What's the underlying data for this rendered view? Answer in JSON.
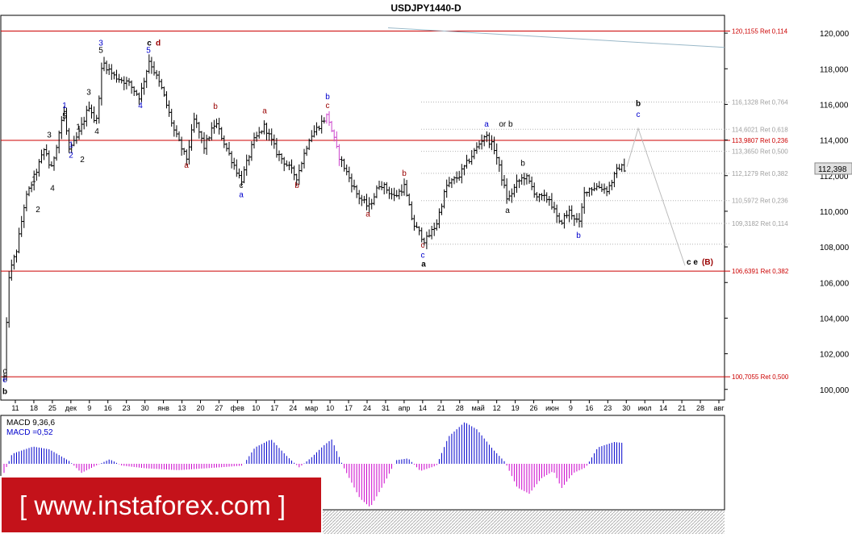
{
  "window": {
    "title": "USDJPY1440-D"
  },
  "colors": {
    "candle": "#000000",
    "resistance": "#cc0000",
    "fibo_dotted": "#b4b4b4",
    "fibo_label": "#a0a0a0",
    "trend": "#9ab8c8",
    "projection": "#bcbcbc",
    "macd_positive": "#0000cc",
    "macd_negative": "#cc00cc",
    "wave_black": "#000000",
    "wave_blue": "#0000cc",
    "wave_red": "#990000",
    "price_box": "#e0e0e0"
  },
  "chart_data": [
    {
      "type": "candlestick",
      "title": "USDJPY1440-D",
      "ylim": [
        99.4,
        121.0
      ],
      "y_ticks": [
        "120,000",
        "118,000",
        "116,000",
        "114,000",
        "112,000",
        "110,000",
        "108,000",
        "106,000",
        "104,000",
        "102,000",
        "100,000"
      ],
      "x_ticks": [
        "11",
        "18",
        "25",
        "дек",
        "9",
        "16",
        "23",
        "30",
        "янв",
        "13",
        "20",
        "27",
        "фев",
        "10",
        "17",
        "24",
        "мар",
        "10",
        "17",
        "24",
        "31",
        "апр",
        "14",
        "21",
        "28",
        "май",
        "12",
        "19",
        "26",
        "июн",
        "9",
        "16",
        "23",
        "30",
        "июл",
        "14",
        "21",
        "28",
        "авг"
      ],
      "current_price": "112,398",
      "resistance_levels": [
        {
          "price": 120.1155,
          "label": "120,1155 Ret 0,114"
        },
        {
          "price": 113.9807,
          "label": "113,9807 Ret 0,236"
        },
        {
          "price": 106.6391,
          "label": "106,6391 Ret 0,382"
        },
        {
          "price": 100.7055,
          "label": "100,7055 Ret 0,500"
        }
      ],
      "fibo_levels": [
        {
          "price": 116.1328,
          "label": "116,1328 Ret 0,764"
        },
        {
          "price": 114.6021,
          "label": "114,6021 Ret 0,618"
        },
        {
          "price": 113.365,
          "label": "113,3650 Ret 0,500"
        },
        {
          "price": 112.1279,
          "label": "112,1279 Ret 0,382"
        },
        {
          "price": 110.5972,
          "label": "110,5972 Ret 0,236"
        },
        {
          "price": 109.3182,
          "label": "109,3182 Ret 0,114"
        },
        {
          "price": 108.15,
          "label": ""
        }
      ],
      "trend_line": [
        {
          "day": 480,
          "price": 120.3
        },
        {
          "day": 897,
          "price": 119.2
        }
      ],
      "projection": [
        {
          "day": 776,
          "price": 112.5
        },
        {
          "day": 790,
          "price": 114.65
        },
        {
          "day": 848,
          "price": 106.95
        }
      ],
      "anchors": [
        {
          "day": 5,
          "price": 100.7
        },
        {
          "day": 9,
          "price": 106.2
        },
        {
          "day": 20,
          "price": 107.9
        },
        {
          "day": 30,
          "price": 110.6
        },
        {
          "day": 42,
          "price": 112.0
        },
        {
          "day": 55,
          "price": 113.6
        },
        {
          "day": 62,
          "price": 112.2
        },
        {
          "day": 78,
          "price": 115.7
        },
        {
          "day": 85,
          "price": 113.3
        },
        {
          "day": 97,
          "price": 114.4
        },
        {
          "day": 110,
          "price": 116.0
        },
        {
          "day": 118,
          "price": 114.8
        },
        {
          "day": 126,
          "price": 118.4
        },
        {
          "day": 140,
          "price": 117.6
        },
        {
          "day": 158,
          "price": 117.2
        },
        {
          "day": 172,
          "price": 116.4
        },
        {
          "day": 184,
          "price": 118.5
        },
        {
          "day": 200,
          "price": 116.8
        },
        {
          "day": 215,
          "price": 114.5
        },
        {
          "day": 230,
          "price": 112.9
        },
        {
          "day": 240,
          "price": 115.2
        },
        {
          "day": 252,
          "price": 113.6
        },
        {
          "day": 266,
          "price": 115.0
        },
        {
          "day": 282,
          "price": 113.3
        },
        {
          "day": 298,
          "price": 111.7
        },
        {
          "day": 313,
          "price": 113.9
        },
        {
          "day": 327,
          "price": 114.8
        },
        {
          "day": 342,
          "price": 113.3
        },
        {
          "day": 367,
          "price": 111.9
        },
        {
          "day": 382,
          "price": 114.1
        },
        {
          "day": 405,
          "price": 115.4
        },
        {
          "day": 418,
          "price": 113.2
        },
        {
          "day": 442,
          "price": 110.9
        },
        {
          "day": 456,
          "price": 110.2
        },
        {
          "day": 470,
          "price": 111.6
        },
        {
          "day": 488,
          "price": 110.8
        },
        {
          "day": 500,
          "price": 111.4
        },
        {
          "day": 511,
          "price": 109.3
        },
        {
          "day": 526,
          "price": 108.3
        },
        {
          "day": 540,
          "price": 109.3
        },
        {
          "day": 552,
          "price": 111.4
        },
        {
          "day": 568,
          "price": 112.0
        },
        {
          "day": 582,
          "price": 113.0
        },
        {
          "day": 600,
          "price": 114.3
        },
        {
          "day": 612,
          "price": 113.5
        },
        {
          "day": 628,
          "price": 110.6
        },
        {
          "day": 640,
          "price": 111.6
        },
        {
          "day": 650,
          "price": 112.0
        },
        {
          "day": 665,
          "price": 110.8
        },
        {
          "day": 680,
          "price": 110.7
        },
        {
          "day": 692,
          "price": 109.3
        },
        {
          "day": 705,
          "price": 110.0
        },
        {
          "day": 717,
          "price": 109.3
        },
        {
          "day": 724,
          "price": 111.2
        },
        {
          "day": 740,
          "price": 111.4
        },
        {
          "day": 752,
          "price": 111.2
        },
        {
          "day": 766,
          "price": 112.5
        },
        {
          "day": 774,
          "price": 112.4
        }
      ],
      "wave_labels": [
        {
          "text": "c",
          "day": 5,
          "price": 100.9,
          "color": "black"
        },
        {
          "text": "e",
          "day": 5,
          "price": 100.4,
          "color": "blue"
        },
        {
          "text": "b",
          "day": 5,
          "price": 99.75,
          "color": "black",
          "bold": true
        },
        {
          "text": "1",
          "day": 41,
          "price": 111.65,
          "color": "black"
        },
        {
          "text": "2",
          "day": 46,
          "price": 109.95,
          "color": "black"
        },
        {
          "text": "3",
          "day": 60,
          "price": 114.15,
          "color": "black"
        },
        {
          "text": "4",
          "day": 64,
          "price": 111.15,
          "color": "black"
        },
        {
          "text": "5",
          "day": 79,
          "price": 115.2,
          "color": "black"
        },
        {
          "text": "1",
          "day": 79,
          "price": 115.8,
          "color": "blue"
        },
        {
          "text": "1",
          "day": 87,
          "price": 113.6,
          "color": "blue"
        },
        {
          "text": "2",
          "day": 87,
          "price": 113.0,
          "color": "blue"
        },
        {
          "text": "1",
          "day": 96,
          "price": 114.6,
          "color": "black"
        },
        {
          "text": "2",
          "day": 101,
          "price": 112.75,
          "color": "black"
        },
        {
          "text": "3",
          "day": 109,
          "price": 116.55,
          "color": "black"
        },
        {
          "text": "4",
          "day": 119,
          "price": 114.35,
          "color": "black"
        },
        {
          "text": "3",
          "day": 124,
          "price": 119.3,
          "color": "blue"
        },
        {
          "text": "5",
          "day": 124,
          "price": 118.9,
          "color": "black"
        },
        {
          "text": "4",
          "day": 173,
          "price": 115.8,
          "color": "blue"
        },
        {
          "text": "c",
          "day": 184,
          "price": 119.3,
          "color": "black",
          "bold": true
        },
        {
          "text": "d",
          "day": 195,
          "price": 119.3,
          "color": "red",
          "bold": true
        },
        {
          "text": "5",
          "day": 183,
          "price": 118.9,
          "color": "blue"
        },
        {
          "text": "a",
          "day": 230,
          "price": 112.45,
          "color": "red"
        },
        {
          "text": "b",
          "day": 266,
          "price": 115.75,
          "color": "red"
        },
        {
          "text": "c",
          "day": 298,
          "price": 111.3,
          "color": "black"
        },
        {
          "text": "a",
          "day": 298,
          "price": 110.8,
          "color": "blue"
        },
        {
          "text": "a",
          "day": 327,
          "price": 115.5,
          "color": "red"
        },
        {
          "text": "b",
          "day": 367,
          "price": 111.3,
          "color": "red"
        },
        {
          "text": "b",
          "day": 405,
          "price": 116.3,
          "color": "blue"
        },
        {
          "text": "c",
          "day": 405,
          "price": 115.8,
          "color": "red"
        },
        {
          "text": "a",
          "day": 455,
          "price": 109.7,
          "color": "red"
        },
        {
          "text": "b",
          "day": 500,
          "price": 112.0,
          "color": "red"
        },
        {
          "text": "c",
          "day": 523,
          "price": 107.95,
          "color": "red"
        },
        {
          "text": "c",
          "day": 523,
          "price": 107.4,
          "color": "blue"
        },
        {
          "text": "a",
          "day": 524,
          "price": 106.9,
          "color": "black",
          "bold": true
        },
        {
          "text": "a",
          "day": 602,
          "price": 114.75,
          "color": "blue"
        },
        {
          "text": "or b",
          "day": 626,
          "price": 114.75,
          "color": "black"
        },
        {
          "text": "b",
          "day": 647,
          "price": 112.55,
          "color": "black"
        },
        {
          "text": "a",
          "day": 628,
          "price": 109.9,
          "color": "black"
        },
        {
          "text": "b",
          "day": 716,
          "price": 108.5,
          "color": "blue"
        },
        {
          "text": "b",
          "day": 790,
          "price": 115.9,
          "color": "black",
          "bold": true
        },
        {
          "text": "c",
          "day": 790,
          "price": 115.3,
          "color": "blue"
        },
        {
          "text": "c e",
          "day": 857,
          "price": 107.0,
          "color": "black",
          "bold": true
        },
        {
          "text": "(B)",
          "day": 876,
          "price": 107.0,
          "color": "red",
          "bold": true
        }
      ]
    },
    {
      "type": "bar",
      "title": "MACD 9,36,6",
      "subtitle": "MACD =0,52",
      "ylim": [
        -2.6,
        2.6
      ],
      "anchors": [
        {
          "day": 4,
          "value": -0.5
        },
        {
          "day": 14,
          "value": 0.55
        },
        {
          "day": 40,
          "value": 0.95
        },
        {
          "day": 60,
          "value": 0.8
        },
        {
          "day": 85,
          "value": 0.15
        },
        {
          "day": 100,
          "value": -0.5
        },
        {
          "day": 118,
          "value": -0.1
        },
        {
          "day": 135,
          "value": 0.25
        },
        {
          "day": 150,
          "value": -0.1
        },
        {
          "day": 180,
          "value": -0.25
        },
        {
          "day": 220,
          "value": -0.35
        },
        {
          "day": 270,
          "value": -0.2
        },
        {
          "day": 300,
          "value": -0.1
        },
        {
          "day": 315,
          "value": 0.9
        },
        {
          "day": 335,
          "value": 1.35
        },
        {
          "day": 355,
          "value": 0.4
        },
        {
          "day": 370,
          "value": -0.2
        },
        {
          "day": 385,
          "value": 0.35
        },
        {
          "day": 400,
          "value": 1.0
        },
        {
          "day": 410,
          "value": 1.35
        },
        {
          "day": 425,
          "value": -0.2
        },
        {
          "day": 445,
          "value": -1.9
        },
        {
          "day": 458,
          "value": -2.4
        },
        {
          "day": 475,
          "value": -1.1
        },
        {
          "day": 490,
          "value": 0.2
        },
        {
          "day": 505,
          "value": 0.3
        },
        {
          "day": 520,
          "value": -0.4
        },
        {
          "day": 540,
          "value": -0.1
        },
        {
          "day": 555,
          "value": 1.5
        },
        {
          "day": 575,
          "value": 2.3
        },
        {
          "day": 590,
          "value": 1.9
        },
        {
          "day": 610,
          "value": 0.8
        },
        {
          "day": 625,
          "value": 0.1
        },
        {
          "day": 640,
          "value": -1.3
        },
        {
          "day": 655,
          "value": -1.65
        },
        {
          "day": 670,
          "value": -0.8
        },
        {
          "day": 685,
          "value": -0.4
        },
        {
          "day": 695,
          "value": -1.35
        },
        {
          "day": 710,
          "value": -0.5
        },
        {
          "day": 725,
          "value": -0.2
        },
        {
          "day": 740,
          "value": 0.9
        },
        {
          "day": 760,
          "value": 1.2
        },
        {
          "day": 772,
          "value": 1.15
        }
      ]
    }
  ],
  "branding": {
    "logo_text": "[ www.instaforex.com ]"
  }
}
